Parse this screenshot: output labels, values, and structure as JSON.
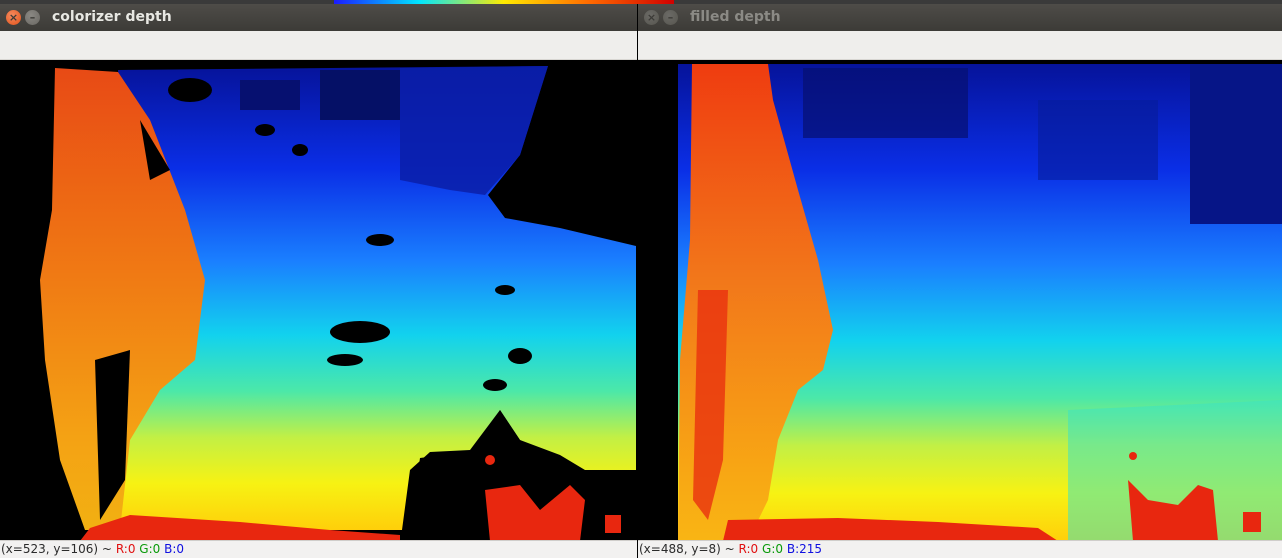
{
  "windows": [
    {
      "id": "colorizer",
      "title": "colorizer depth",
      "status": {
        "coords": "(x=523, y=106) ~",
        "r": "R:0",
        "g": "G:0",
        "b": "B:0"
      },
      "colors": {
        "near": "#e8270f",
        "far": "#06139a",
        "hole": "#000000"
      }
    },
    {
      "id": "filled",
      "title": "filled depth",
      "status": {
        "coords": "(x=488, y=8) ~",
        "r": "R:0",
        "g": "G:0",
        "b": "B:215"
      },
      "colors": {
        "near": "#e8270f",
        "far": "#06139a"
      }
    }
  ],
  "buttons": {
    "close_glyph": "×",
    "minimize_glyph": "–"
  }
}
